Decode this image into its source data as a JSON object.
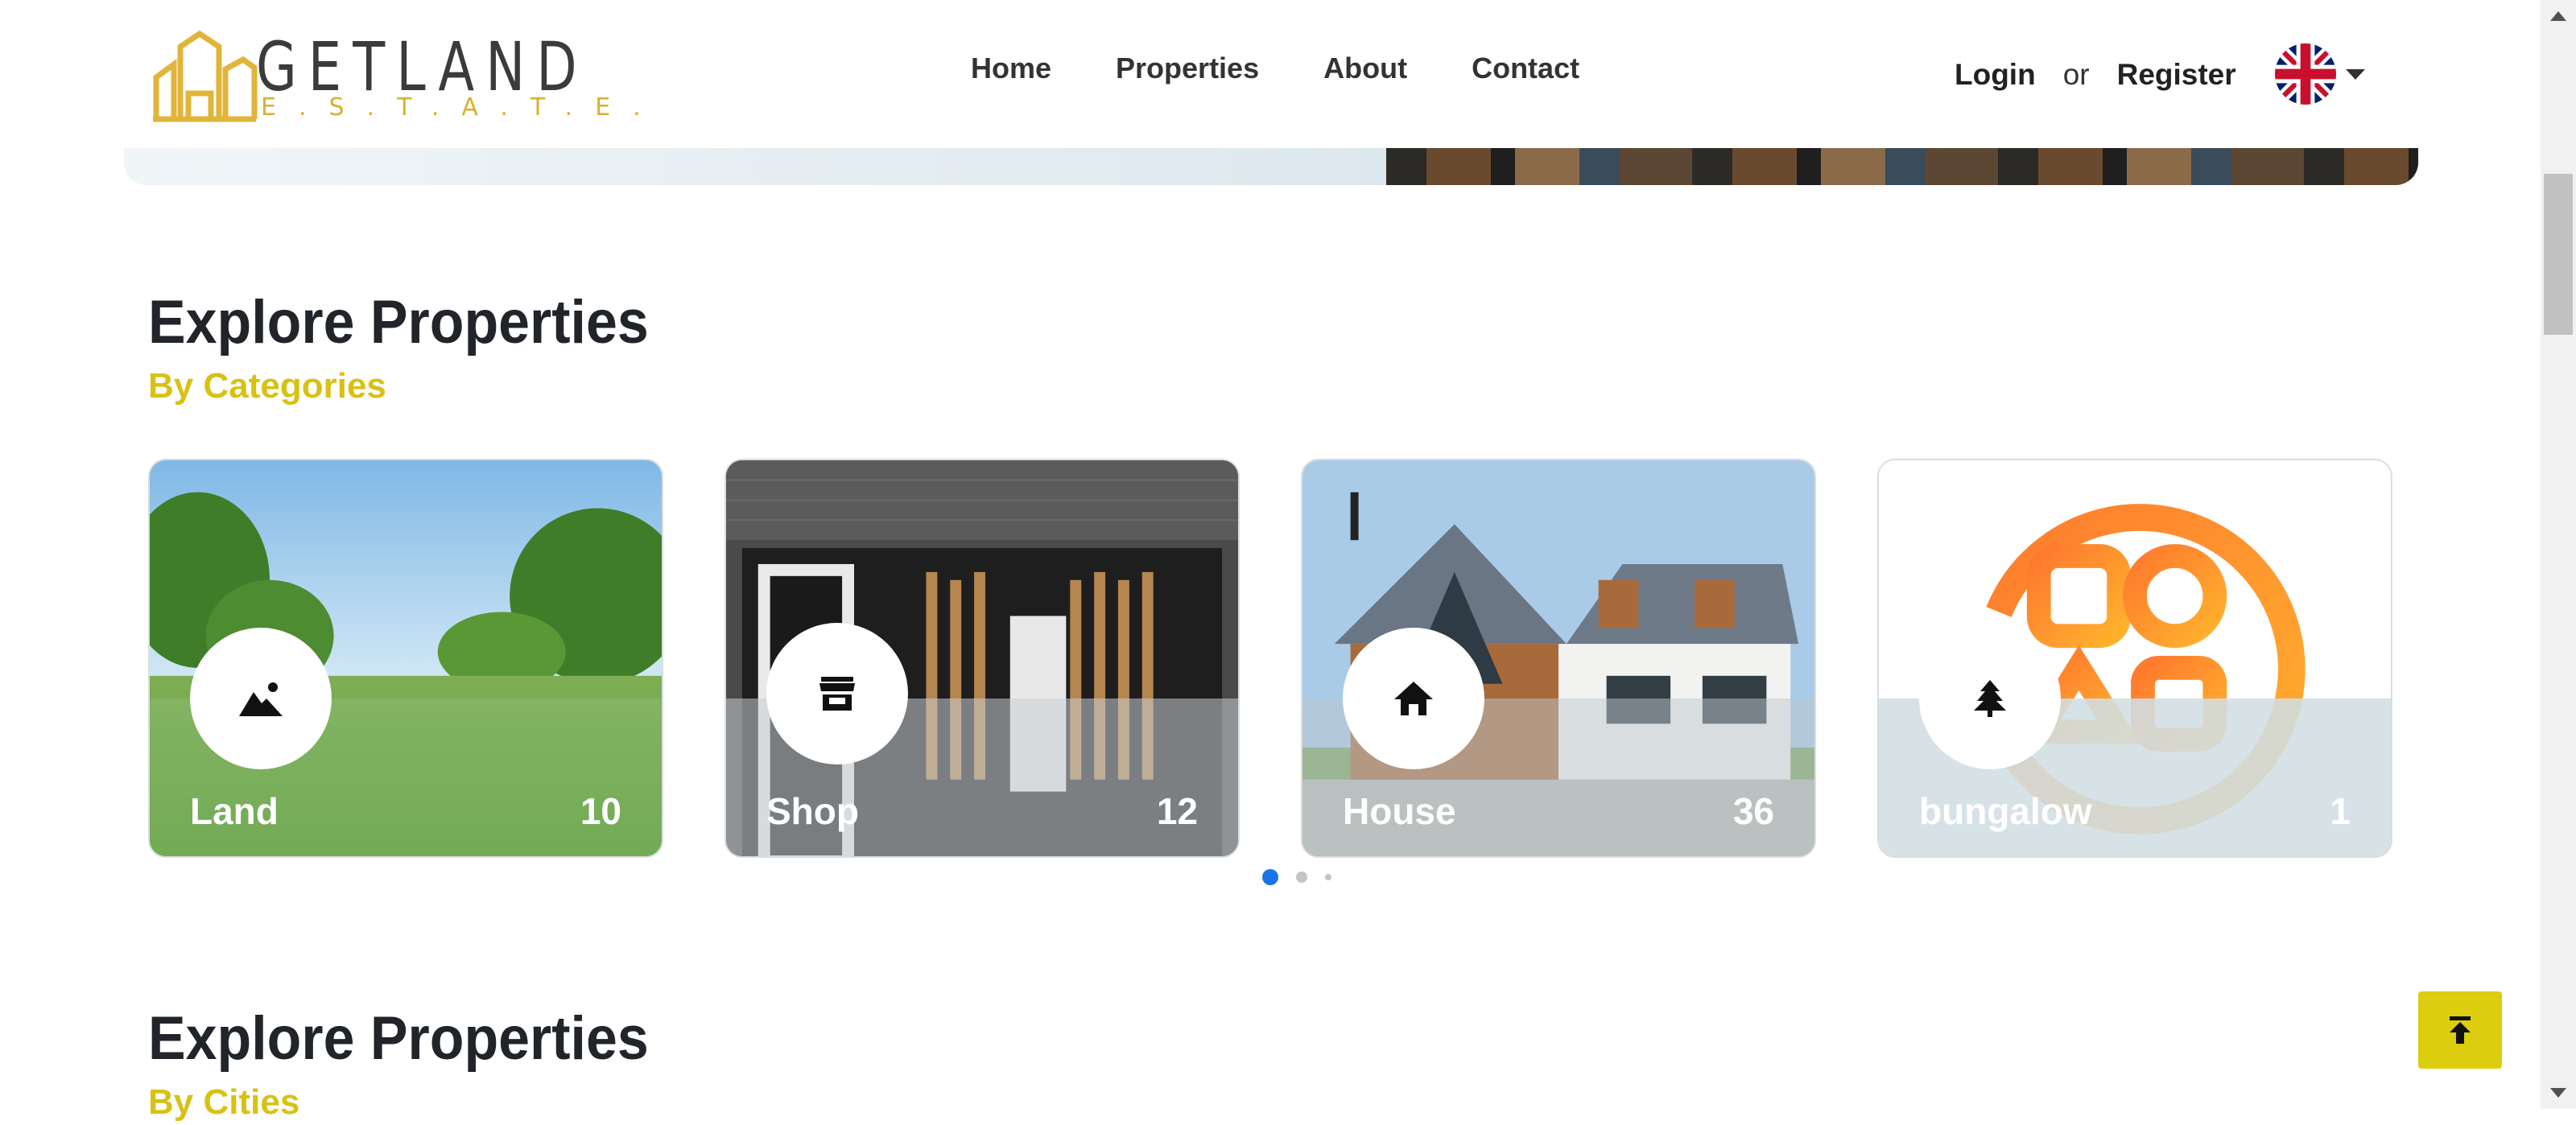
{
  "header": {
    "logo": {
      "word": "GETLAND",
      "sub": "E.S.T.A.T.E."
    },
    "nav": [
      "Home",
      "Properties",
      "About",
      "Contact"
    ],
    "login": "Login",
    "or": "or",
    "register": "Register",
    "language_icon": "uk-flag-icon"
  },
  "sections": {
    "categories": {
      "title": "Explore Properties",
      "subtitle": "By Categories"
    },
    "cities": {
      "title": "Explore Properties",
      "subtitle": "By Cities"
    }
  },
  "categories": [
    {
      "name": "Land",
      "count": "10",
      "icon": "landscape-icon"
    },
    {
      "name": "Shop",
      "count": "12",
      "icon": "store-icon"
    },
    {
      "name": "House",
      "count": "36",
      "icon": "home-icon"
    },
    {
      "name": "bungalow",
      "count": "1",
      "icon": "tree-icon"
    }
  ],
  "carousel": {
    "pages": 3,
    "active_page": 1
  },
  "colors": {
    "accent": "#d8c114",
    "scroll_top_button": "#dccd0e",
    "active_dot": "#1a73e8",
    "inactive_dot": "#c4c4c4"
  }
}
